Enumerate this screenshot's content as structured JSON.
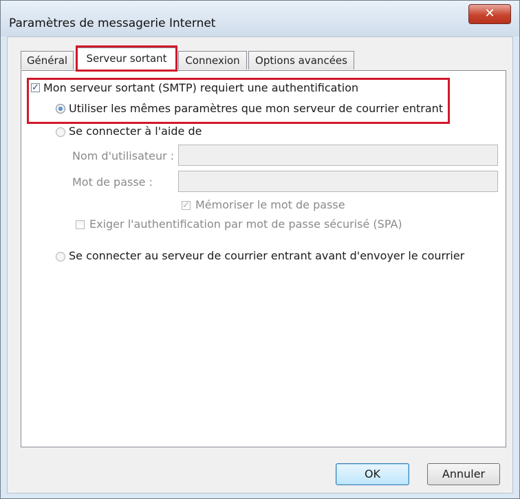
{
  "window": {
    "title": "Paramètres de messagerie Internet",
    "close_glyph": "✕"
  },
  "tabs": [
    {
      "label": "Général",
      "active": false
    },
    {
      "label": "Serveur sortant",
      "active": true
    },
    {
      "label": "Connexion",
      "active": false
    },
    {
      "label": "Options avancées",
      "active": false
    }
  ],
  "smtp": {
    "auth_required_label": "Mon serveur sortant (SMTP) requiert une authentification",
    "auth_required_checked": true,
    "use_same_label": "Utiliser les mêmes paramètres que mon serveur de courrier entrant",
    "use_same_selected": true,
    "connect_with_label": "Se connecter à l'aide de",
    "connect_with_selected": false,
    "username_label": "Nom d'utilisateur :",
    "username_value": "",
    "password_label": "Mot de passe :",
    "password_value": "",
    "remember_label": "Mémoriser le mot de passe",
    "remember_checked": true,
    "spa_label": "Exiger l'authentification par mot de passe sécurisé (SPA)",
    "spa_checked": false,
    "connect_incoming_label": "Se connecter au serveur de courrier entrant avant d'envoyer le courrier",
    "connect_incoming_selected": false
  },
  "buttons": {
    "ok": "OK",
    "cancel": "Annuler"
  },
  "colors": {
    "highlight": "#d0182b",
    "close_button": "#c8452f"
  },
  "icons": {
    "check": "✓"
  }
}
